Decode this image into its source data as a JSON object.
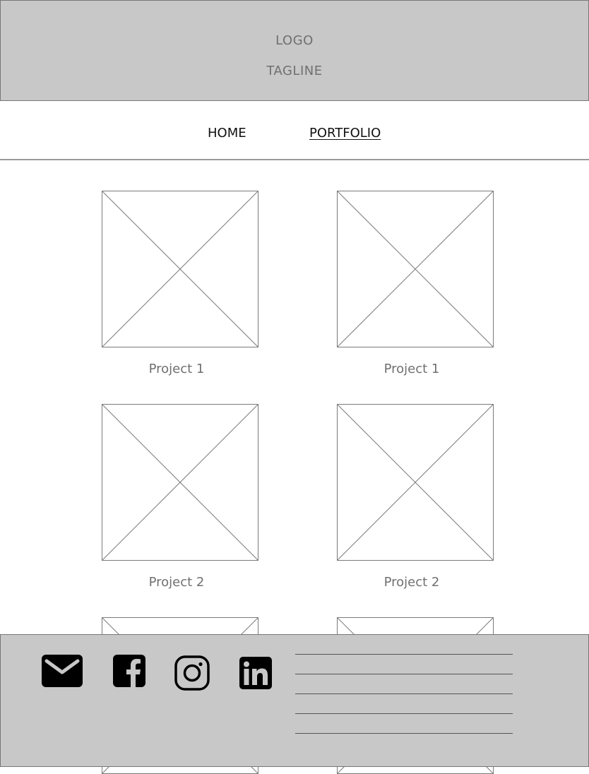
{
  "header": {
    "logo": "LOGO",
    "tagline": "TAGLINE"
  },
  "nav": {
    "home": "HOME",
    "portfolio": "PORTFOLIO"
  },
  "projects": [
    {
      "title": "Project 1"
    },
    {
      "title": "Project 1"
    },
    {
      "title": "Project 2"
    },
    {
      "title": "Project 2"
    }
  ],
  "footer": {
    "icons": [
      "mail-icon",
      "facebook-icon",
      "instagram-icon",
      "linkedin-icon"
    ]
  }
}
